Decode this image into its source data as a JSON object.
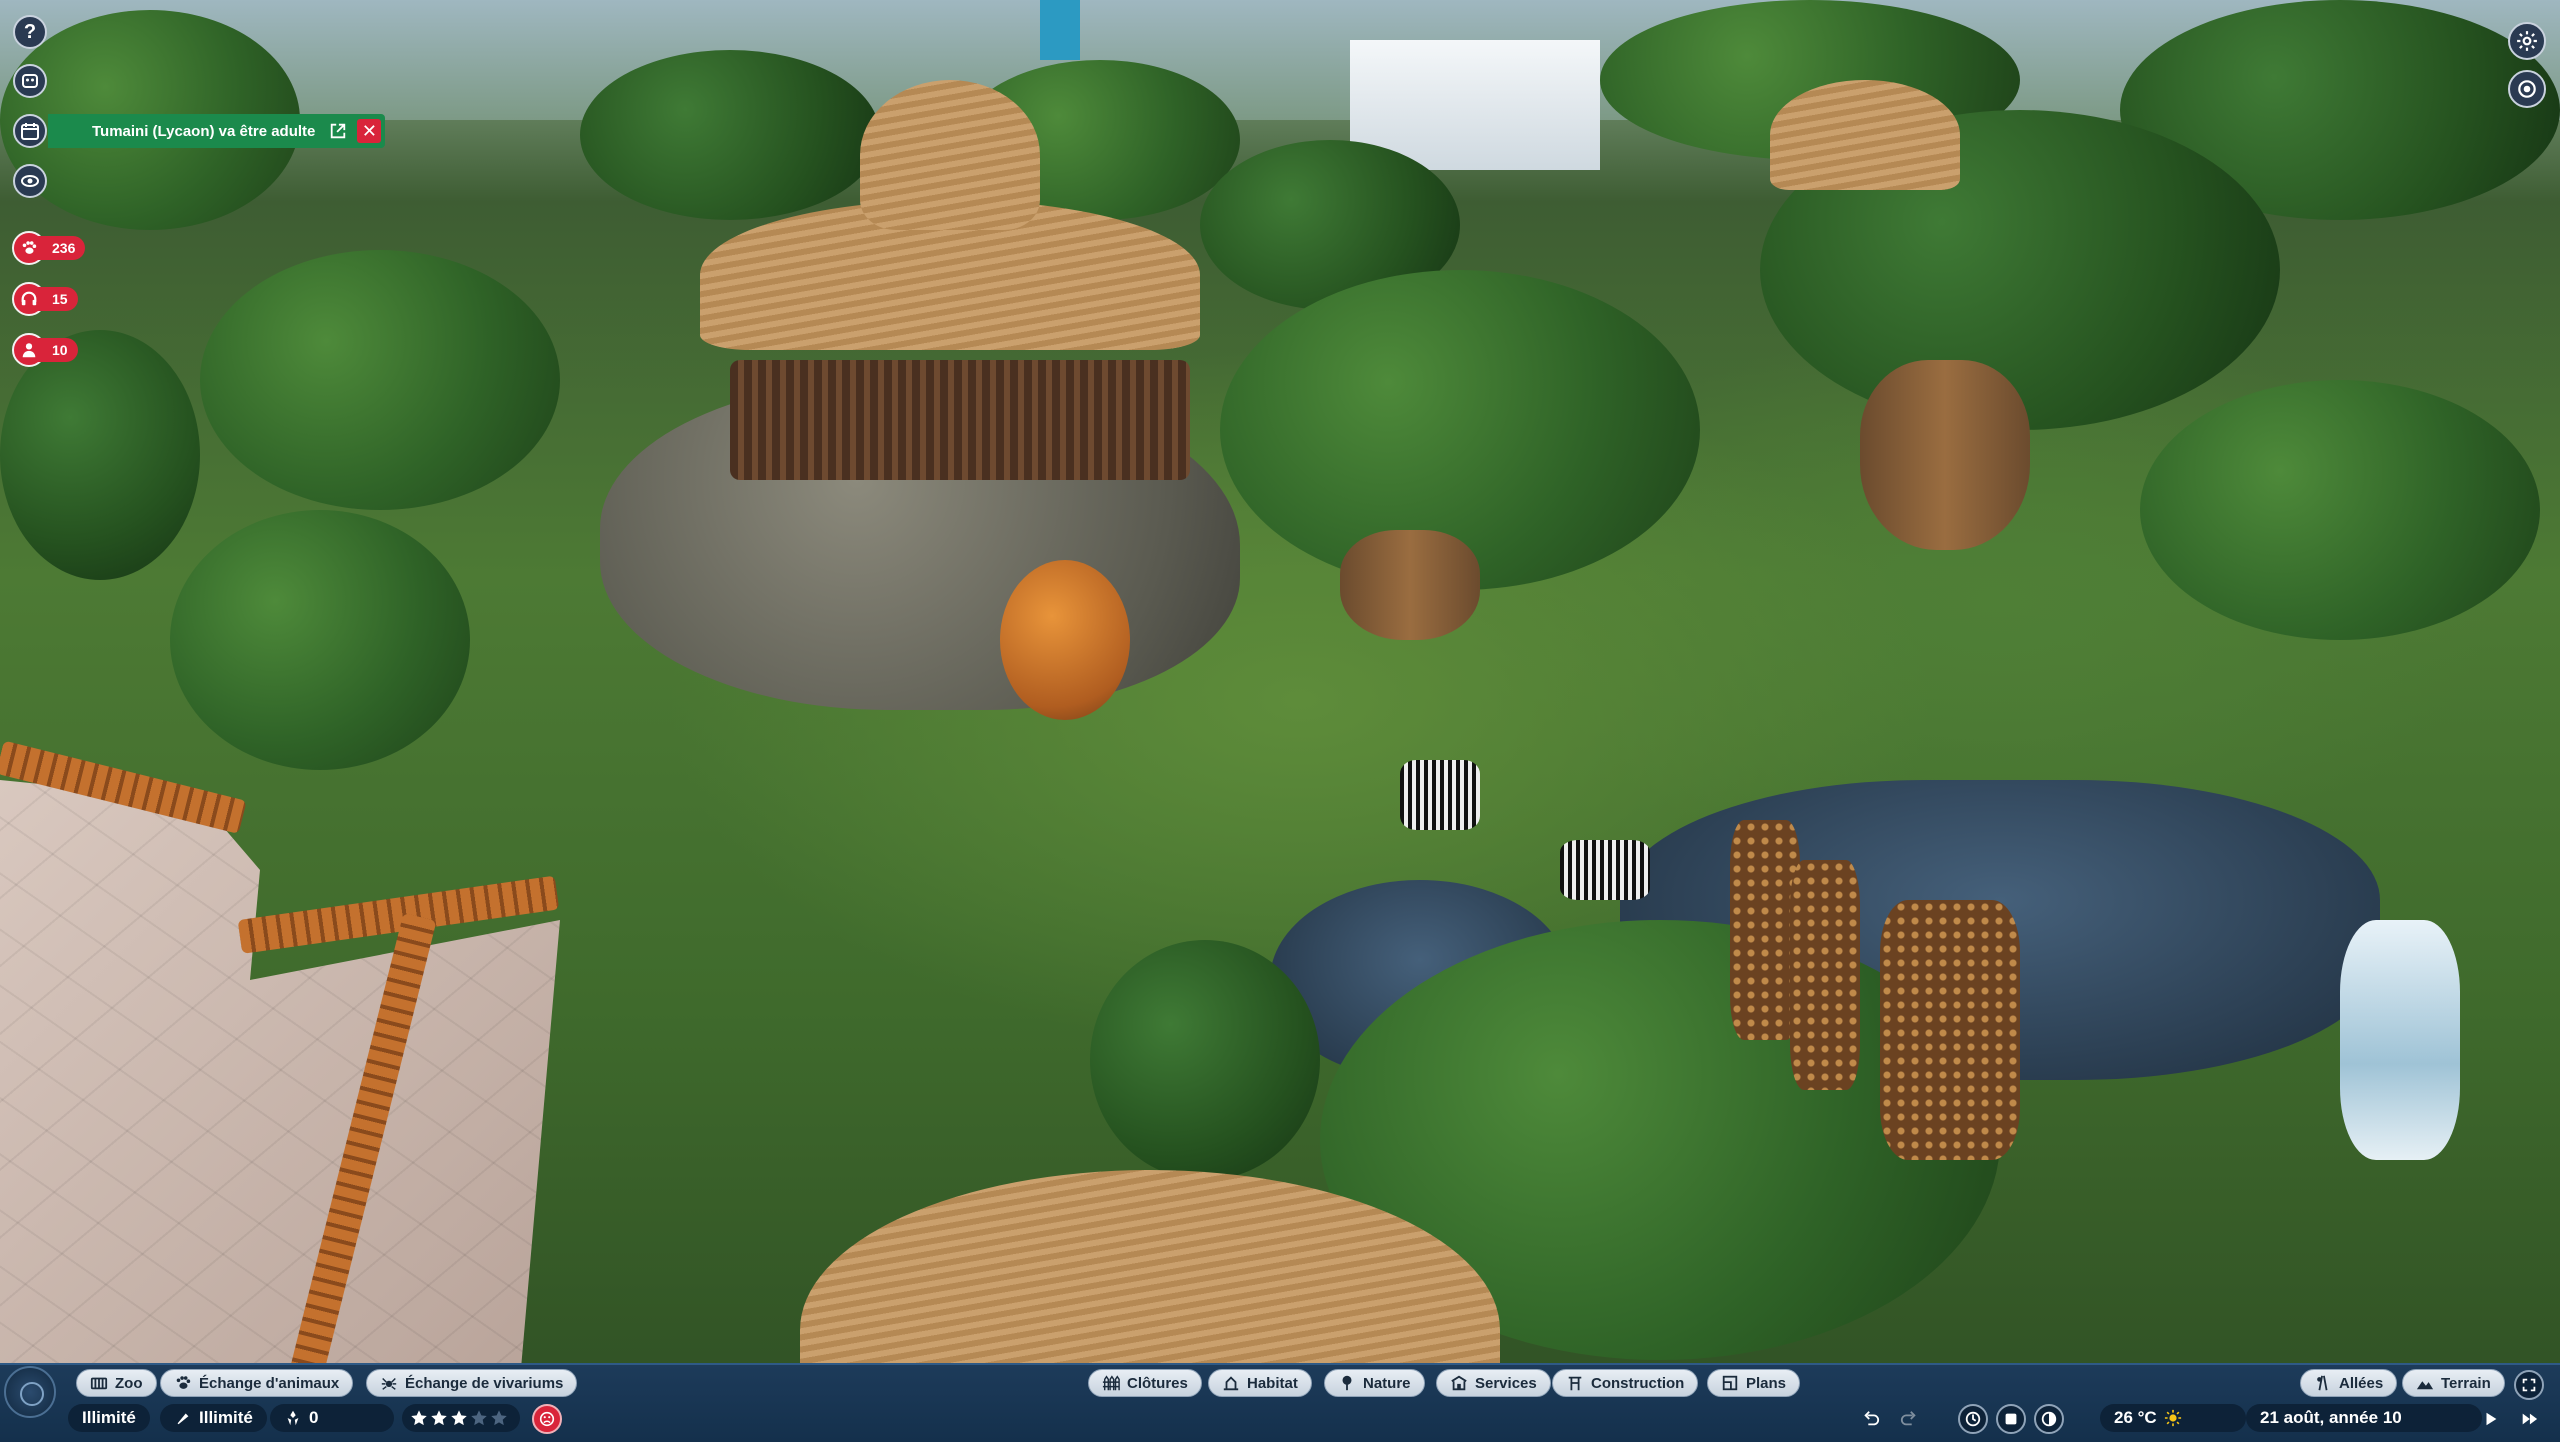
{
  "hud": {
    "notification": {
      "text": "Tumaini (Lycaon) va être adulte",
      "close": "✕"
    },
    "counters": {
      "animals": "236",
      "guests_group": "15",
      "staff": "10"
    },
    "help": "?"
  },
  "toolbar": {
    "left_tabs": [
      {
        "label": "Zoo",
        "icon": "zoo-icon"
      },
      {
        "label": "Échange d'animaux",
        "icon": "paw-icon"
      },
      {
        "label": "Échange de vivariums",
        "icon": "spider-icon"
      }
    ],
    "center_tabs": [
      {
        "label": "Clôtures",
        "icon": "fence-icon"
      },
      {
        "label": "Habitat",
        "icon": "habitat-icon"
      },
      {
        "label": "Nature",
        "icon": "tree-icon"
      },
      {
        "label": "Services",
        "icon": "services-icon"
      },
      {
        "label": "Construction",
        "icon": "construction-icon"
      },
      {
        "label": "Plans",
        "icon": "plans-icon"
      }
    ],
    "right_tabs": [
      {
        "label": "Allées",
        "icon": "path-icon"
      },
      {
        "label": "Terrain",
        "icon": "terrain-icon"
      }
    ]
  },
  "status": {
    "money": "Illimité",
    "research": "Illimité",
    "conservation": "0",
    "rating_stars": 3,
    "rating_max": 5,
    "temperature": "26 °C",
    "date": "21 août, année 10"
  },
  "colors": {
    "accent_red": "#d9243a",
    "notif_green": "#1b8a4c",
    "bar_blue": "#14304c"
  }
}
